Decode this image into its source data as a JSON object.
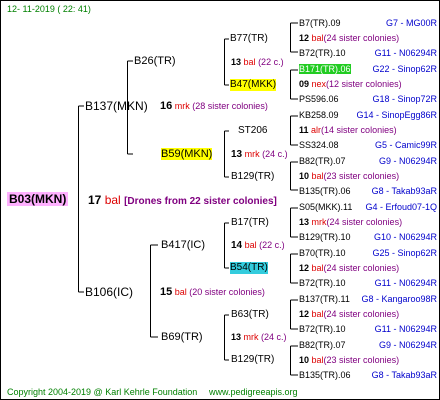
{
  "header": {
    "date": "12- 11-2019 ( 22: 41)"
  },
  "footer": {
    "copyright": "Copyright 2004-2019 @ Karl Kehrle Foundation",
    "site": "www.pedigreeapis.org"
  },
  "root": {
    "name": "B03(MKN)",
    "num": "17",
    "race": "bal",
    "note": "[Drones from 22 sister colonies]"
  },
  "gen1": [
    {
      "name": "B137(MKN)",
      "num": "16",
      "race": "mrk",
      "note": "(28 sister colonies)"
    },
    {
      "name": "B106(IC)",
      "num": "15",
      "race": "bal",
      "note": "(20 sister colonies)"
    }
  ],
  "gen2": [
    {
      "name": "B26(TR)"
    },
    {
      "name": "B59(MKN)",
      "num": "13",
      "race": "mrk",
      "note": "(24 c.)"
    },
    {
      "name": "B417(IC)",
      "num": "14",
      "race": "bal",
      "note": "(22 c.)"
    },
    {
      "name": "B69(TR)"
    }
  ],
  "gen3": [
    {
      "name": "B77(TR)",
      "num": "13",
      "race": "bal",
      "note": "(22 c.)"
    },
    {
      "name": "B47(MKK)"
    },
    {
      "name": "ST206",
      "num": "11",
      "race": "alr"
    },
    {
      "name": "B129(TR)"
    },
    {
      "name": "B17(TR)"
    },
    {
      "name": "B54(TR)"
    },
    {
      "name": "B63(TR)",
      "num": "13",
      "race": "mrk",
      "note": "(24 c.)"
    },
    {
      "name": "B129(TR)"
    }
  ],
  "gen4": [
    {
      "name": "B7(TR).09",
      "code": "G7 - MG00R",
      "num": "12",
      "race": "bal",
      "note": "(24 sister colonies)"
    },
    {
      "name": "B72(TR).10",
      "code": "G11 - N06294R"
    },
    {
      "name": "B171(TR).06",
      "code": "G22 - Sinop62R",
      "num": "09",
      "race": "nex",
      "note": "(12 sister colonies)"
    },
    {
      "name": "PS596.06",
      "code": "G18 - Sinop72R"
    },
    {
      "name": "KB258.09",
      "code": "G14 - SinopEgg86R",
      "num": "11",
      "race": "alr",
      "note": "(14 sister colonies)"
    },
    {
      "name": "SS324.08",
      "code": "G5 - Camic99R"
    },
    {
      "name": "B82(TR).07",
      "code": "G9 - N06294R",
      "num": "10",
      "race": "bal",
      "note": "(23 sister colonies)"
    },
    {
      "name": "B135(TR).06",
      "code": "G8 - Takab93aR"
    },
    {
      "name": "S05(MKK).11",
      "code": "G4 - Erfoud07-1Q",
      "num": "13",
      "race": "mrk",
      "note": "(24 sister colonies)"
    },
    {
      "name": "B129(TR).10",
      "code": "G10 - N06294R"
    },
    {
      "name": "B70(TR).10",
      "code": "G25 - Sinop62R",
      "num": "12",
      "race": "bal",
      "note": "(24 sister colonies)"
    },
    {
      "name": "B72(TR).10",
      "code": "G11 - N06294R"
    },
    {
      "name": "B137(TR).11",
      "code": "G8 - Kangaroo98R",
      "num": "12",
      "race": "bal",
      "note": "(24 sister colonies)"
    },
    {
      "name": "B72(TR).10",
      "code": "G11 - N06294R"
    },
    {
      "name": "B82(TR).07",
      "code": "G9 - N06294R",
      "num": "10",
      "race": "bal",
      "note": "(23 sister colonies)"
    },
    {
      "name": "B135(TR).06",
      "code": "G8 - Takab93aR"
    }
  ]
}
